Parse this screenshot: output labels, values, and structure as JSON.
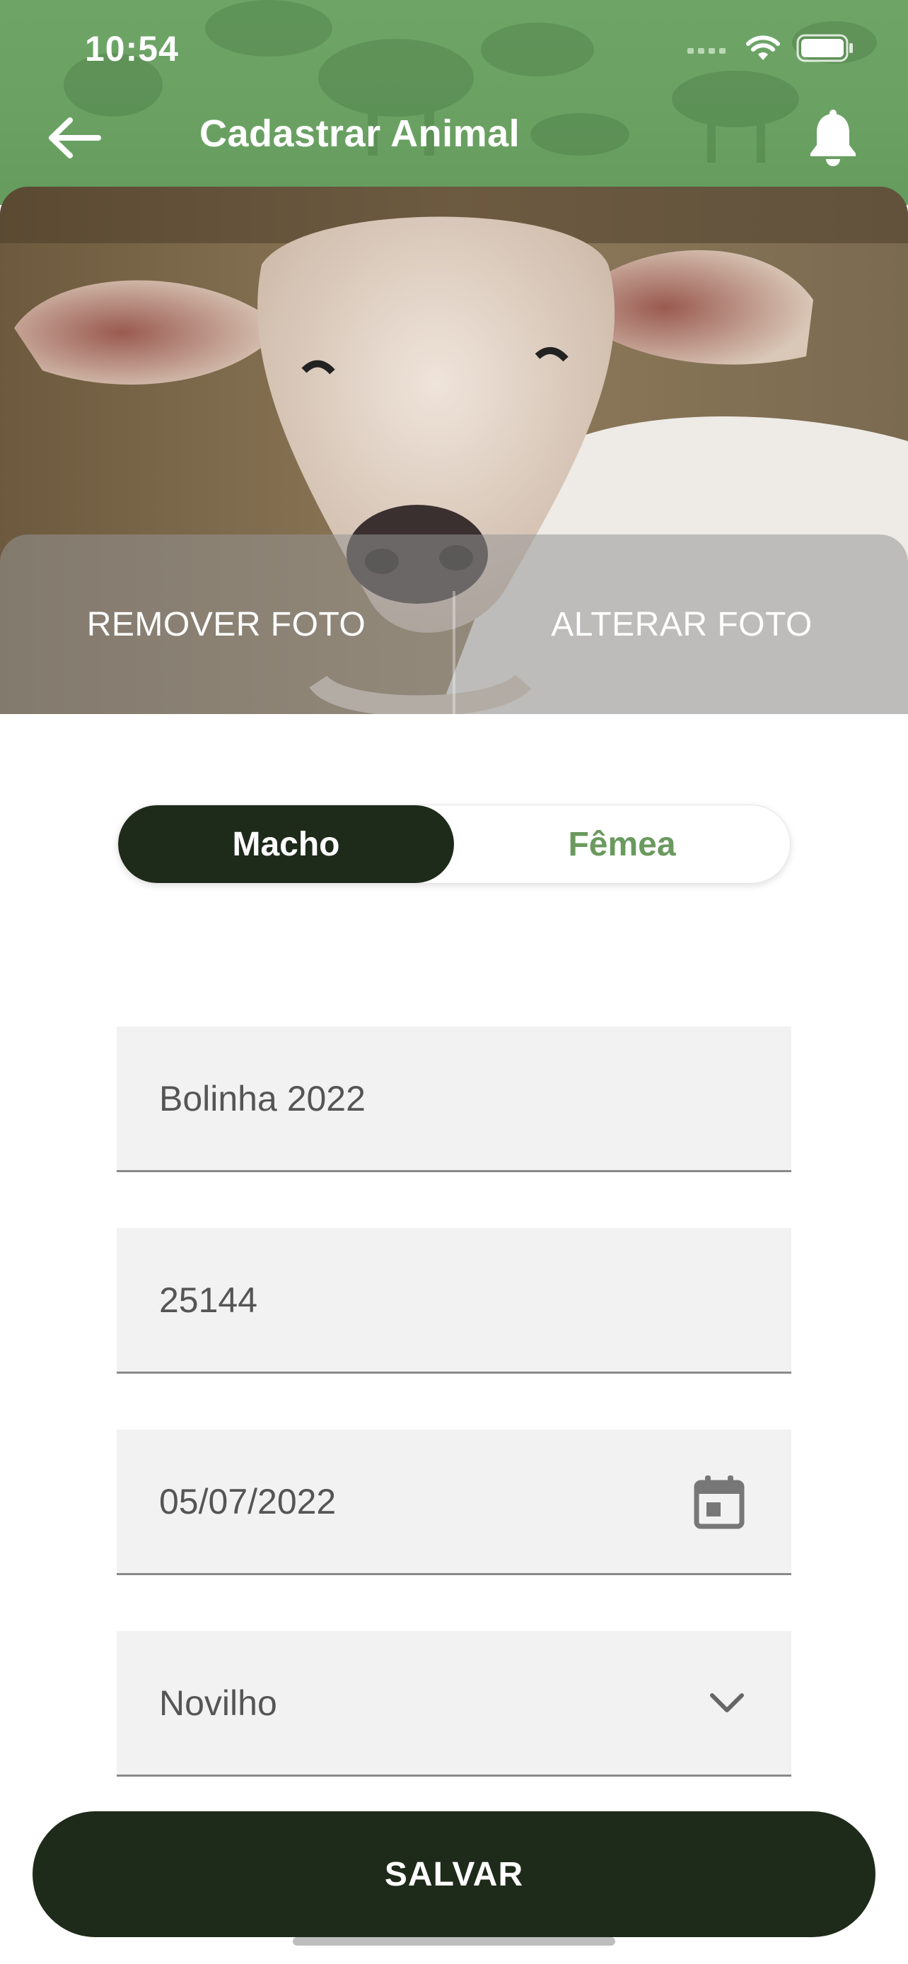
{
  "status_bar": {
    "time": "10:54"
  },
  "header": {
    "title": "Cadastrar Animal",
    "back_icon": "arrow-left-icon",
    "notification_icon": "bell-icon"
  },
  "photo": {
    "remove_label": "REMOVER FOTO",
    "change_label": "ALTERAR FOTO"
  },
  "sex_toggle": {
    "options": [
      {
        "label": "Macho",
        "selected": true
      },
      {
        "label": "Fêmea",
        "selected": false
      }
    ]
  },
  "form": {
    "name": {
      "value": "Bolinha 2022"
    },
    "tag": {
      "value": "25144"
    },
    "birth_date": {
      "value": "05/07/2022",
      "icon": "calendar-icon"
    },
    "category": {
      "value": "Novilho",
      "icon": "chevron-down-icon"
    }
  },
  "actions": {
    "save_label": "SALVAR"
  },
  "colors": {
    "header_green": "#6ea567",
    "dark_green": "#1f2b1a",
    "accent_green": "#6a9a5e",
    "field_bg": "#f2f2f2"
  }
}
